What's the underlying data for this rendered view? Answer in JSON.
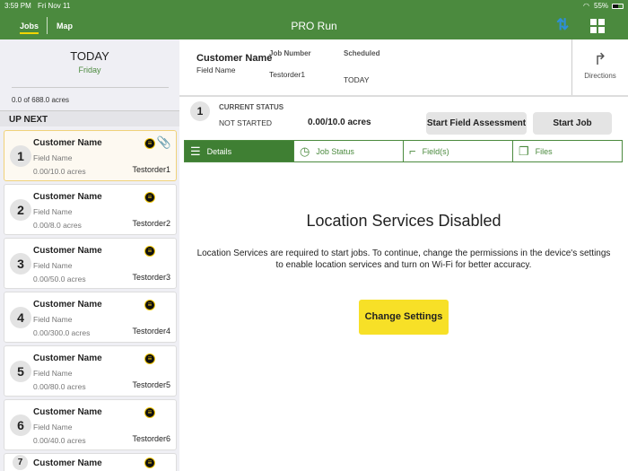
{
  "status_bar": {
    "time": "3:59 PM",
    "date": "Fri Nov 11",
    "battery": "55%"
  },
  "header": {
    "tabs": [
      {
        "label": "Jobs"
      },
      {
        "label": "Map"
      }
    ],
    "title": "PRO Run"
  },
  "sidebar": {
    "day": "TODAY",
    "weekday": "Friday",
    "acres_summary": "0.0 of 688.0 acres",
    "section": "UP NEXT",
    "jobs": [
      {
        "num": "1",
        "customer": "Customer Name",
        "field": "Field Name",
        "acres": "0.00/10.0 acres",
        "order": "Testorder1"
      },
      {
        "num": "2",
        "customer": "Customer Name",
        "field": "Field Name",
        "acres": "0.00/8.0 acres",
        "order": "Testorder2"
      },
      {
        "num": "3",
        "customer": "Customer Name",
        "field": "Field Name",
        "acres": "0.00/50.0 acres",
        "order": "Testorder3"
      },
      {
        "num": "4",
        "customer": "Customer Name",
        "field": "Field Name",
        "acres": "0.00/300.0 acres",
        "order": "Testorder4"
      },
      {
        "num": "5",
        "customer": "Customer Name",
        "field": "Field Name",
        "acres": "0.00/80.0 acres",
        "order": "Testorder5"
      },
      {
        "num": "6",
        "customer": "Customer Name",
        "field": "Field Name",
        "acres": "0.00/40.0 acres",
        "order": "Testorder6"
      },
      {
        "num": "7",
        "customer": "Customer Name"
      }
    ]
  },
  "job": {
    "customer": "Customer Name",
    "field": "Field Name",
    "job_number_label": "Job Number",
    "job_number": "Testorder1",
    "scheduled_label": "Scheduled",
    "scheduled": "TODAY",
    "directions": "Directions",
    "step": "1",
    "status_label": "CURRENT STATUS",
    "status": "NOT STARTED",
    "acres": "0.00/10.0 acres",
    "assess_btn": "Start Field Assessment",
    "start_btn": "Start Job"
  },
  "tabs": [
    {
      "label": "Details"
    },
    {
      "label": "Job Status"
    },
    {
      "label": "Field(s)"
    },
    {
      "label": "Files"
    }
  ],
  "message": {
    "title": "Location Services Disabled",
    "body": "Location Services are required to start jobs. To continue, change the permissions in the device's settings to enable location services and turn on Wi-Fi for better accuracy.",
    "button": "Change Settings"
  }
}
